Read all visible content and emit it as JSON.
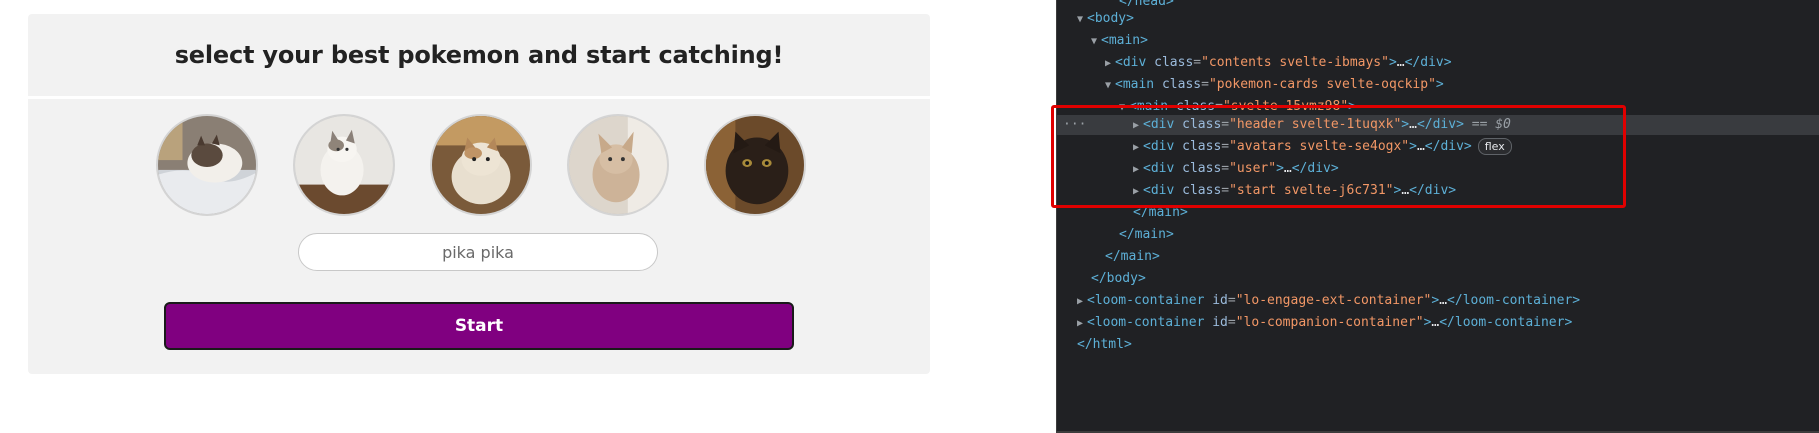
{
  "page": {
    "title": "select your best pokemon and start catching!",
    "avatars": [
      {
        "name": "cat-avatar-1"
      },
      {
        "name": "cat-avatar-2"
      },
      {
        "name": "cat-avatar-3"
      },
      {
        "name": "cat-avatar-4"
      },
      {
        "name": "cat-avatar-5"
      }
    ],
    "input_placeholder": "pika pika",
    "start_label": "Start",
    "accent_color": "#800080"
  },
  "devtools": {
    "lines": [
      {
        "html": "&lt;/head&gt;"
      },
      {
        "tag": "body"
      },
      {
        "tag": "main"
      },
      {
        "class": "contents svelte-ibmays"
      },
      {
        "class": "pokemon-cards svelte-oqckip"
      },
      {
        "class": "svelte-15vmz98"
      },
      {
        "class": "header svelte-1tuqxk",
        "marker": "== $0"
      },
      {
        "class": "avatars svelte-se4ogx",
        "badge": "flex"
      },
      {
        "class": "user"
      },
      {
        "class": "start svelte-j6c731"
      },
      {
        "close": "main"
      },
      {
        "close": "main"
      },
      {
        "close": "main"
      },
      {
        "close": "body"
      },
      {
        "id": "lo-engage-ext-container"
      },
      {
        "id": "lo-companion-container"
      },
      {
        "close": "html"
      }
    ],
    "text": {
      "l0": "</head>",
      "body": "body",
      "main": "main",
      "div": "div",
      "class_attr": "class",
      "id_attr": "id",
      "loom": "loom-container",
      "c_contents": "\"contents svelte-ibmays\"",
      "c_cards": "\"pokemon-cards svelte-oqckip\"",
      "c_15": "\"svelte-15vmz98\"",
      "c_header": "\"header svelte-1tuqxk\"",
      "c_avatars": "\"avatars svelte-se4ogx\"",
      "c_user": "\"user\"",
      "c_start": "\"start svelte-j6c731\"",
      "id_engage": "\"lo-engage-ext-container\"",
      "id_companion": "\"lo-companion-container\"",
      "html": "html",
      "marker": "== $0",
      "badge": "flex",
      "ellipsis": "…",
      "dots": "···"
    }
  }
}
